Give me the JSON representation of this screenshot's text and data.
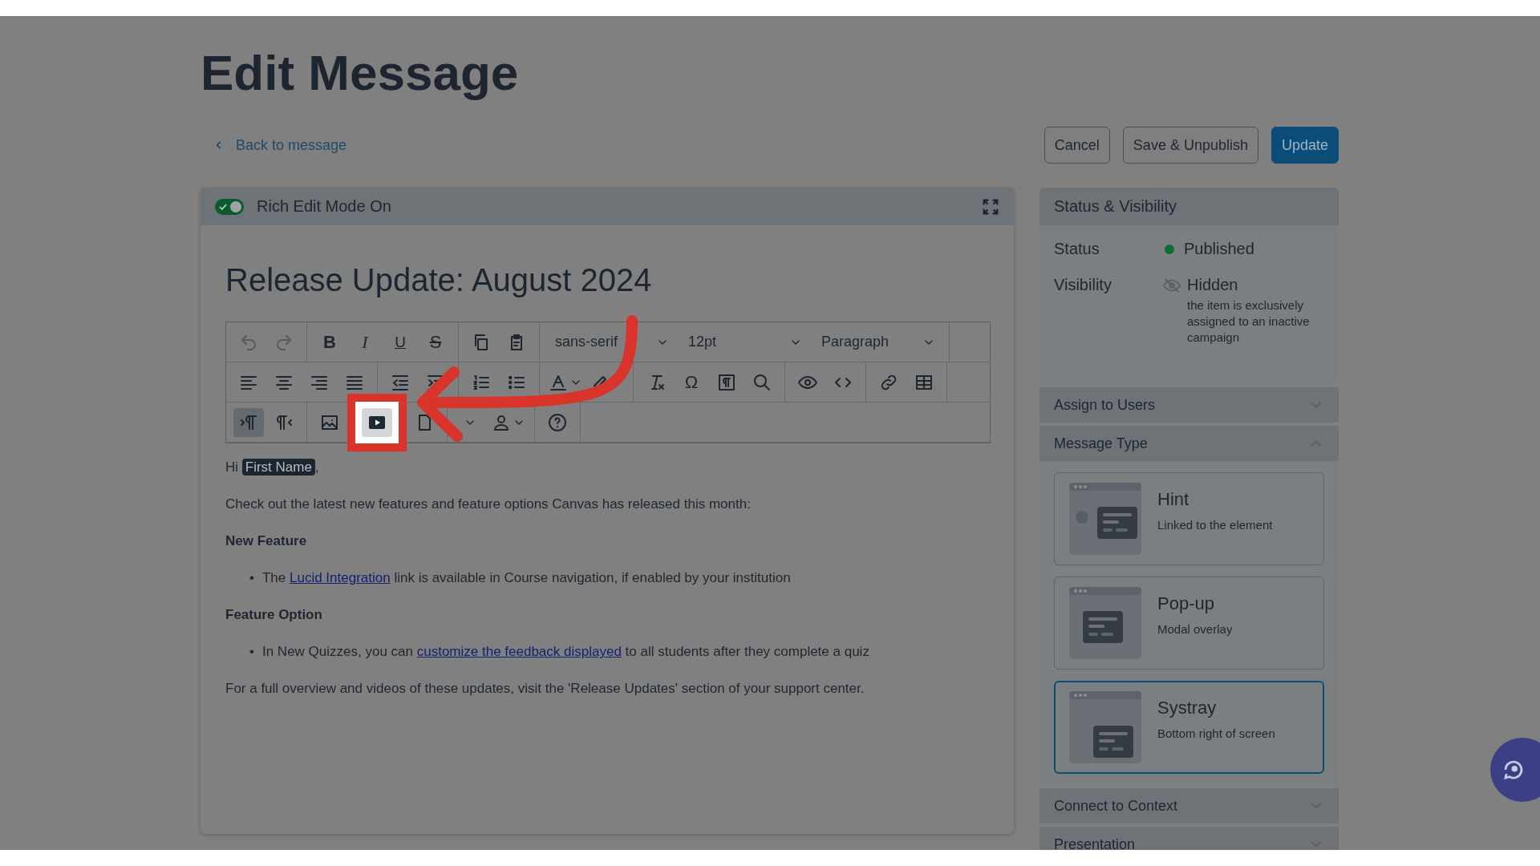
{
  "page": {
    "title": "Edit Message",
    "back_link": "Back to message",
    "buttons": [
      {
        "label": "Cancel",
        "kind": "secondary"
      },
      {
        "label": "Save & Unpublish",
        "kind": "secondary"
      },
      {
        "label": "Update",
        "kind": "primary"
      }
    ]
  },
  "editor": {
    "mode_toggle": {
      "label": "Rich Edit Mode On",
      "on": true
    },
    "message_title": "Release Update: August 2024",
    "toolbar": {
      "rows": [
        {
          "groups": [
            {
              "items": [
                {
                  "kind": "undo",
                  "disabled": true,
                  "active": false,
                  "highlighted": false
                },
                {
                  "kind": "redo",
                  "disabled": true,
                  "active": false,
                  "highlighted": false
                }
              ]
            },
            {
              "items": [
                {
                  "kind": "bold",
                  "glyph": "B",
                  "disabled": false,
                  "active": false,
                  "highlighted": false
                },
                {
                  "kind": "italic",
                  "glyph": "I",
                  "disabled": false,
                  "active": false,
                  "highlighted": false
                },
                {
                  "kind": "underline",
                  "glyph": "U",
                  "disabled": false,
                  "active": false,
                  "highlighted": false
                },
                {
                  "kind": "strike",
                  "glyph": "S",
                  "disabled": false,
                  "active": false,
                  "highlighted": false
                }
              ]
            },
            {
              "items": [
                {
                  "kind": "copy",
                  "disabled": false,
                  "active": false,
                  "highlighted": false
                },
                {
                  "kind": "paste",
                  "disabled": false,
                  "active": false,
                  "highlighted": false
                }
              ]
            },
            {
              "items": [
                {
                  "kind": "select",
                  "label": "sans-serif",
                  "disabled": false,
                  "active": false,
                  "highlighted": false
                },
                {
                  "kind": "select",
                  "label": "12pt",
                  "disabled": false,
                  "active": false,
                  "highlighted": false
                },
                {
                  "kind": "select",
                  "label": "Paragraph",
                  "disabled": false,
                  "active": false,
                  "highlighted": false
                }
              ]
            }
          ]
        },
        {
          "groups": [
            {
              "items": [
                {
                  "kind": "align-left",
                  "disabled": false,
                  "active": false,
                  "highlighted": false
                },
                {
                  "kind": "align-center",
                  "disabled": false,
                  "active": false,
                  "highlighted": false
                },
                {
                  "kind": "align-right",
                  "disabled": false,
                  "active": false,
                  "highlighted": false
                },
                {
                  "kind": "justify",
                  "disabled": false,
                  "active": false,
                  "highlighted": false
                }
              ]
            },
            {
              "items": [
                {
                  "kind": "outdent",
                  "disabled": false,
                  "active": false,
                  "highlighted": false
                },
                {
                  "kind": "indent",
                  "disabled": false,
                  "active": false,
                  "highlighted": false
                }
              ]
            },
            {
              "items": [
                {
                  "kind": "ol",
                  "disabled": false,
                  "active": false,
                  "highlighted": false
                },
                {
                  "kind": "ul",
                  "disabled": false,
                  "active": false,
                  "highlighted": false
                }
              ]
            },
            {
              "items": [
                {
                  "kind": "forecolor",
                  "disabled": false,
                  "active": false,
                  "highlighted": false
                },
                {
                  "kind": "backcolor",
                  "disabled": false,
                  "active": false,
                  "highlighted": false
                }
              ]
            },
            {
              "items": [
                {
                  "kind": "clear-format",
                  "disabled": false,
                  "active": false,
                  "highlighted": false
                },
                {
                  "kind": "charmap",
                  "glyph": "Ω",
                  "disabled": false,
                  "active": false,
                  "highlighted": false
                },
                {
                  "kind": "blocks",
                  "disabled": false,
                  "active": false,
                  "highlighted": false
                },
                {
                  "kind": "search",
                  "disabled": false,
                  "active": false,
                  "highlighted": false
                }
              ]
            },
            {
              "items": [
                {
                  "kind": "preview",
                  "disabled": false,
                  "active": false,
                  "highlighted": false
                },
                {
                  "kind": "code",
                  "disabled": false,
                  "active": false,
                  "highlighted": false
                }
              ]
            },
            {
              "items": [
                {
                  "kind": "link",
                  "disabled": false,
                  "active": false,
                  "highlighted": false
                },
                {
                  "kind": "table",
                  "disabled": false,
                  "active": false,
                  "highlighted": false
                }
              ]
            }
          ]
        },
        {
          "groups": [
            {
              "items": [
                {
                  "kind": "ltr",
                  "disabled": false,
                  "active": true,
                  "highlighted": false
                },
                {
                  "kind": "rtl",
                  "disabled": false,
                  "active": false,
                  "highlighted": false
                }
              ]
            },
            {
              "items": [
                {
                  "kind": "image",
                  "disabled": false,
                  "active": false,
                  "highlighted": false
                },
                {
                  "kind": "video",
                  "disabled": false,
                  "active": false,
                  "highlighted": true
                },
                {
                  "kind": "document",
                  "disabled": false,
                  "active": false,
                  "highlighted": false
                }
              ]
            },
            {
              "items": [
                {
                  "kind": "menu",
                  "disabled": false,
                  "active": false,
                  "highlighted": false
                },
                {
                  "kind": "person",
                  "disabled": false,
                  "active": false,
                  "highlighted": false
                }
              ]
            },
            {
              "items": [
                {
                  "kind": "help",
                  "disabled": false,
                  "active": false,
                  "highlighted": false
                }
              ]
            }
          ]
        }
      ]
    },
    "body": [
      {
        "kind": "greeting",
        "text": "Hi",
        "token": "First Name",
        "after": ","
      },
      {
        "kind": "text",
        "text": "Check out the latest new features and feature options Canvas has released this month:"
      },
      {
        "kind": "heading",
        "text": "New Feature"
      },
      {
        "kind": "bullet",
        "marker": "•",
        "before": "The",
        "link": "Lucid Integration",
        "after": "link is available in Course navigation, if enabled by your institution"
      },
      {
        "kind": "heading",
        "text": "Feature Option"
      },
      {
        "kind": "bullet",
        "marker": "•",
        "before": "In New Quizzes, you can",
        "link": "customize the feedback displayed",
        "after": "to all students after they complete a quiz"
      },
      {
        "kind": "text",
        "text": "For a full overview and videos of these updates, visit the 'Release Updates' section of your support center."
      }
    ]
  },
  "sidebar": {
    "title": "Status & Visibility",
    "rows": [
      {
        "label": "Status",
        "kind": "dot",
        "value": "Published",
        "color": "#0d6b36"
      },
      {
        "label": "Visibility",
        "kind": "hidden",
        "value": "Hidden",
        "note": "the item is exclusively assigned to an inactive campaign"
      }
    ],
    "sections": [
      {
        "title": "Assign to Users",
        "expanded": false
      },
      {
        "title": "Message Type",
        "expanded": true,
        "options": [
          {
            "kind": "hint",
            "title": "Hint",
            "subtitle": "Linked to the element",
            "selected": false
          },
          {
            "kind": "popup",
            "title": "Pop-up",
            "subtitle": "Modal overlay",
            "selected": false
          },
          {
            "kind": "systray",
            "title": "Systray",
            "subtitle": "Bottom right of screen",
            "selected": true
          }
        ]
      },
      {
        "title": "Connect to Context",
        "expanded": false
      },
      {
        "title": "Presentation",
        "expanded": false
      }
    ]
  }
}
